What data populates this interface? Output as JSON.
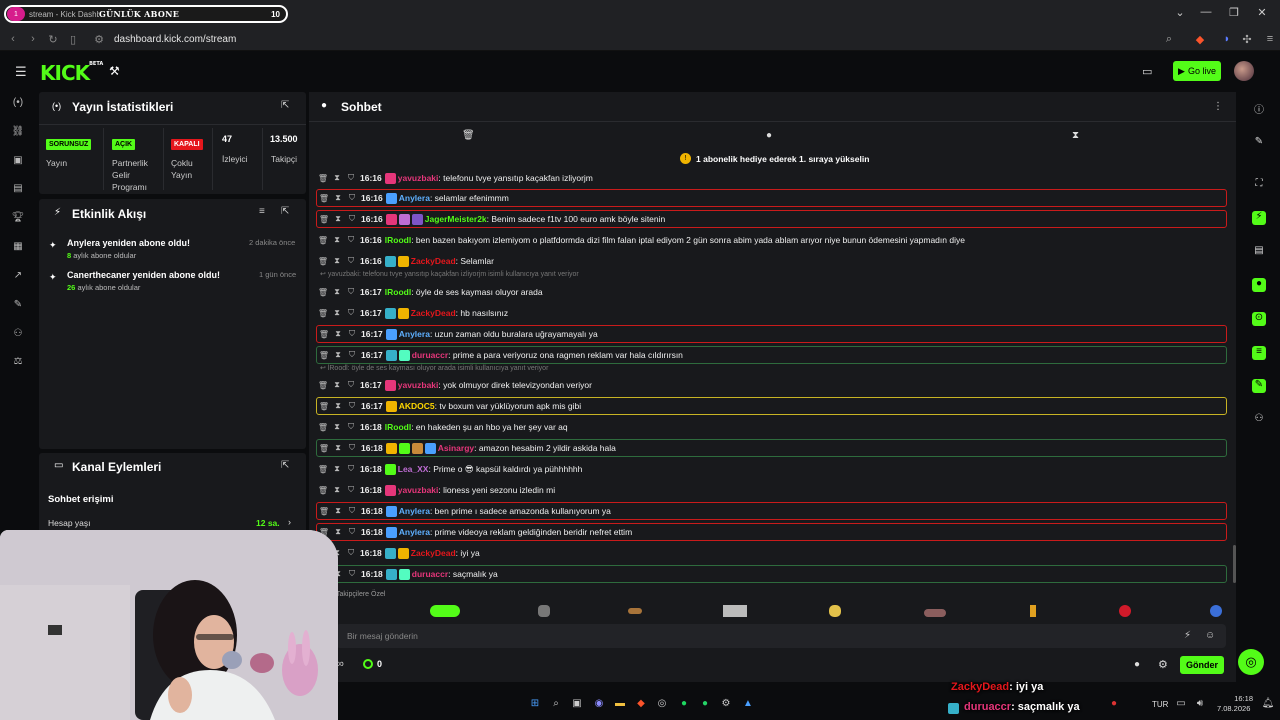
{
  "browser": {
    "tab_title": "stream - Kick Dashboard",
    "url": "dashboard.kick.com/stream",
    "banner": {
      "icon_text": "1",
      "label": "GÜNLÜK ABONE",
      "count": "10"
    }
  },
  "header": {
    "logo": "KICK",
    "logo_beta": "BETA",
    "go_live": "Go live"
  },
  "stats_panel": {
    "title": "Yayın İstatistikleri",
    "items": [
      {
        "badge": "SORUNSUZ",
        "badge_color": "#53fc18",
        "label": "Yayın"
      },
      {
        "badge": "AÇIK",
        "badge_color": "#53fc18",
        "label": "Partnerlik Gelir Programı"
      },
      {
        "badge": "KAPALI",
        "badge_color": "#e5171c",
        "label": "Çoklu Yayın"
      },
      {
        "value": "47",
        "label": "İzleyici"
      },
      {
        "value": "13.500",
        "label": "Takipçi"
      }
    ]
  },
  "activity_panel": {
    "title": "Etkinlik Akışı",
    "events": [
      {
        "title": "Anylera yeniden abone oldu!",
        "count": "8",
        "suffix": "aylık abone oldular",
        "time": "2 dakika önce"
      },
      {
        "title": "Canerthecaner yeniden abone oldu!",
        "count": "26",
        "suffix": "aylık abone oldular",
        "time": "1 gün önce"
      }
    ]
  },
  "channel_panel": {
    "title": "Kanal Eylemleri",
    "section": "Sohbet erişimi",
    "row_label": "Hesap yaşı",
    "row_value": "12 sa."
  },
  "chat": {
    "title": "Sohbet",
    "pinned": "1 abonelik hediye ederek 1. sıraya yükselin",
    "messages": [
      {
        "time": "16:16",
        "user": "yavuzbaki",
        "color": "#e5367a",
        "text": ": telefonu tvye yansıtıp kaçakfan izliyorjm",
        "hl": "",
        "badges": [
          "#e5367a"
        ]
      },
      {
        "time": "16:16",
        "user": "Anylera",
        "color": "#5eb0ff",
        "text": ": selamlar efenimmm",
        "hl": "red",
        "badges": [
          "#4aa0ff"
        ]
      },
      {
        "time": "16:16",
        "user": "JagerMeister2k",
        "color": "#53fc18",
        "text": ": Benim sadece f1tv 100 euro amk böyle sitenin",
        "hl": "red",
        "badges": [
          "#e5367a",
          "#bf6dd4",
          "#7d55c7"
        ]
      },
      {
        "time": "16:16",
        "user": "lRoodl",
        "color": "#53fc18",
        "text": ": ben bazen bakıyom izlemiyom o platfdormda dizi film falan iptal ediyom 2 gün sonra abim yada ablam arıyor niye bunun ödemesini yapmadın diye",
        "hl": "",
        "badges": []
      },
      {
        "time": "16:16",
        "user": "ZackyDead",
        "color": "#e5171c",
        "text": ": Selamlar",
        "hl": "",
        "badges": [
          "#36b0c9",
          "#f0b400"
        ]
      },
      {
        "time": "16:17",
        "user": "lRoodl",
        "color": "#53fc18",
        "text": ": öyle de ses kayması oluyor arada",
        "hl": "",
        "badges": []
      },
      {
        "time": "16:17",
        "user": "ZackyDead",
        "color": "#e5171c",
        "text": ": hb nasılsınız",
        "hl": "",
        "badges": [
          "#36b0c9",
          "#f0b400"
        ]
      },
      {
        "time": "16:17",
        "user": "Anylera",
        "color": "#5eb0ff",
        "text": ": uzun zaman oldu buralara uğrayamayalı ya",
        "hl": "red",
        "badges": [
          "#4aa0ff"
        ]
      },
      {
        "time": "16:17",
        "user": "duruaccr",
        "color": "#e5367a",
        "text": ": prime a para veriyoruz ona ragmen reklam var hala cıldırırsın",
        "hl": "green",
        "badges": [
          "#36b0c9",
          "#53fcc0"
        ]
      },
      {
        "time": "16:17",
        "user": "yavuzbaki",
        "color": "#e5367a",
        "text": ": yok olmuyor direk televizyondan veriyor",
        "hl": "",
        "badges": [
          "#e5367a"
        ]
      },
      {
        "time": "16:17",
        "user": "AKDOC5",
        "color": "#ffd700",
        "text": ": tv boxum var yüklüyorum apk mis gibi",
        "hl": "yellow",
        "badges": [
          "#f0b400"
        ]
      },
      {
        "time": "16:18",
        "user": "lRoodl",
        "color": "#53fc18",
        "text": ": en hakeden şu an hbo ya her şey var aq",
        "hl": "",
        "badges": []
      },
      {
        "time": "16:18",
        "user": "Asinargy",
        "color": "#e5367a",
        "text": ": amazon hesabim 2 yildir askida hala",
        "hl": "green",
        "badges": [
          "#f0b400",
          "#53fc18",
          "#c98a3a",
          "#4aa0ff"
        ]
      },
      {
        "time": "16:18",
        "user": "Lea_XX",
        "color": "#bf6dd4",
        "text": ": Prime o 😎 kapsül kaldırdı ya pühhhhhh",
        "hl": "",
        "badges": [
          "#53fc18"
        ]
      },
      {
        "time": "16:18",
        "user": "yavuzbaki",
        "color": "#e5367a",
        "text": ": lioness yeni sezonu izledin mi",
        "hl": "",
        "badges": [
          "#e5367a"
        ]
      },
      {
        "time": "16:18",
        "user": "Anylera",
        "color": "#5eb0ff",
        "text": ": ben prime ı sadece amazonda kullanıyorum ya",
        "hl": "red",
        "badges": [
          "#4aa0ff"
        ]
      },
      {
        "time": "16:18",
        "user": "Anylera",
        "color": "#5eb0ff",
        "text": ": prime videoya reklam geldiğinden beridir nefret ettim",
        "hl": "red",
        "badges": [
          "#4aa0ff"
        ]
      },
      {
        "time": "16:18",
        "user": "ZackyDead",
        "color": "#e5171c",
        "text": ": iyi ya",
        "hl": "",
        "badges": [
          "#36b0c9",
          "#f0b400"
        ]
      },
      {
        "time": "16:18",
        "user": "duruaccr",
        "color": "#e5367a",
        "text": ": saçmalık ya",
        "hl": "green",
        "badges": [
          "#36b0c9",
          "#53fcc0"
        ]
      }
    ],
    "replies": [
      {
        "after_index": 4,
        "text": "yavuzbaki: telefonu tvye yansıtıp kaçakfan izliyorjm isimli kullanıcıya yanıt veriyor"
      },
      {
        "after_index": 8,
        "text": "lRoodl: öyle de ses kayması oluyor arada isimli kullanıcıya yanıt veriyor"
      }
    ],
    "emote_label": "Takipçilere Özel",
    "input_placeholder": "Bir mesaj gönderin",
    "points": "0",
    "send": "Gönder"
  },
  "overlay": {
    "line1_user": "ZackyDead",
    "line1_text": ": iyi ya",
    "line2_user": "duruaccr",
    "line2_text": ": saçmalık ya"
  },
  "taskbar": {
    "lang": "TUR",
    "time": "16:18",
    "date": "7.08.2026"
  }
}
